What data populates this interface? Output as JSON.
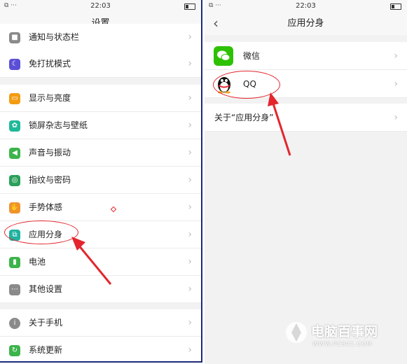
{
  "left": {
    "status": {
      "time": "22:03",
      "left": "⧉ ···"
    },
    "title": "设置",
    "items": [
      {
        "label": "通知与状态栏",
        "color": "#8a8a8a",
        "glyph": "■"
      },
      {
        "label": "免打扰模式",
        "color": "#5b4fd6",
        "glyph": "☾"
      },
      {
        "label": "显示与亮度",
        "color": "#f39c12",
        "glyph": "▭"
      },
      {
        "label": "锁屏杂志与壁纸",
        "color": "#1fb89a",
        "glyph": "✿"
      },
      {
        "label": "声音与振动",
        "color": "#3cb44b",
        "glyph": "◀"
      },
      {
        "label": "指纹与密码",
        "color": "#2aa05a",
        "glyph": "◎"
      },
      {
        "label": "手势体感",
        "color": "#f0932b",
        "glyph": "✋"
      },
      {
        "label": "应用分身",
        "color": "#1fb2a0",
        "glyph": "⧉"
      },
      {
        "label": "电池",
        "color": "#3cb44b",
        "glyph": "▮"
      },
      {
        "label": "其他设置",
        "color": "#8a8a8a",
        "glyph": "⋯"
      },
      {
        "label": "关于手机",
        "color": "#8a8a8a",
        "glyph": "i"
      },
      {
        "label": "系统更新",
        "color": "#3cb44b",
        "glyph": "↻"
      }
    ]
  },
  "right": {
    "status": {
      "time": "22:03",
      "left": "⧉ ···"
    },
    "title": "应用分身",
    "apps": [
      {
        "label": "微信",
        "color": "#2dc100"
      },
      {
        "label": "QQ",
        "color": "#ffffff"
      }
    ],
    "about": "关于“应用分身”"
  },
  "watermark": {
    "name": "电脑百事网",
    "url": "WWW.PC841.COM"
  },
  "colors": {
    "annotation": "#e3262e",
    "frame": "#1d2a7a"
  }
}
